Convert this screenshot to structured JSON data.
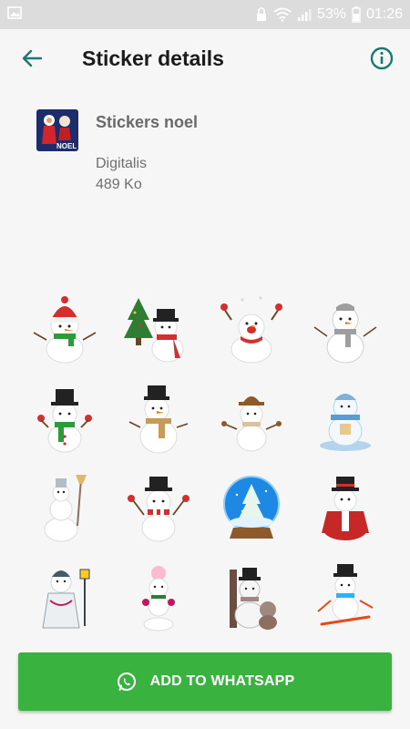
{
  "status_bar": {
    "battery": "53%",
    "time": "01:26",
    "icons": [
      "image-icon",
      "lock-icon",
      "wifi-icon",
      "signal-icon",
      "battery-icon"
    ]
  },
  "app_bar": {
    "title": "Sticker details",
    "back_icon": "arrow-left-icon",
    "info_icon": "info-icon",
    "accent": "#1a7a6e"
  },
  "pack": {
    "name": "Stickers noel",
    "publisher": "Digitalis",
    "size": "489 Ko",
    "tray_label": "NOEL"
  },
  "stickers": [
    {
      "name": "snowman-red-beanie"
    },
    {
      "name": "snowman-with-tree"
    },
    {
      "name": "snowman-cheering"
    },
    {
      "name": "snowman-scarf"
    },
    {
      "name": "snowman-top-hat-waving"
    },
    {
      "name": "snowman-top-hat-brown-scarf"
    },
    {
      "name": "snowman-brown-hat"
    },
    {
      "name": "snowman-blue-scene"
    },
    {
      "name": "snowman-with-broom"
    },
    {
      "name": "snowman-striped-scarf"
    },
    {
      "name": "snow-globe"
    },
    {
      "name": "snowman-red-coat"
    },
    {
      "name": "snowman-ornate-lantern"
    },
    {
      "name": "snowman-stack-ornaments"
    },
    {
      "name": "snowman-with-bear"
    },
    {
      "name": "snowman-skiing"
    }
  ],
  "cta": {
    "label": "ADD TO WHATSAPP",
    "color": "#3ab240",
    "icon": "whatsapp-icon"
  }
}
